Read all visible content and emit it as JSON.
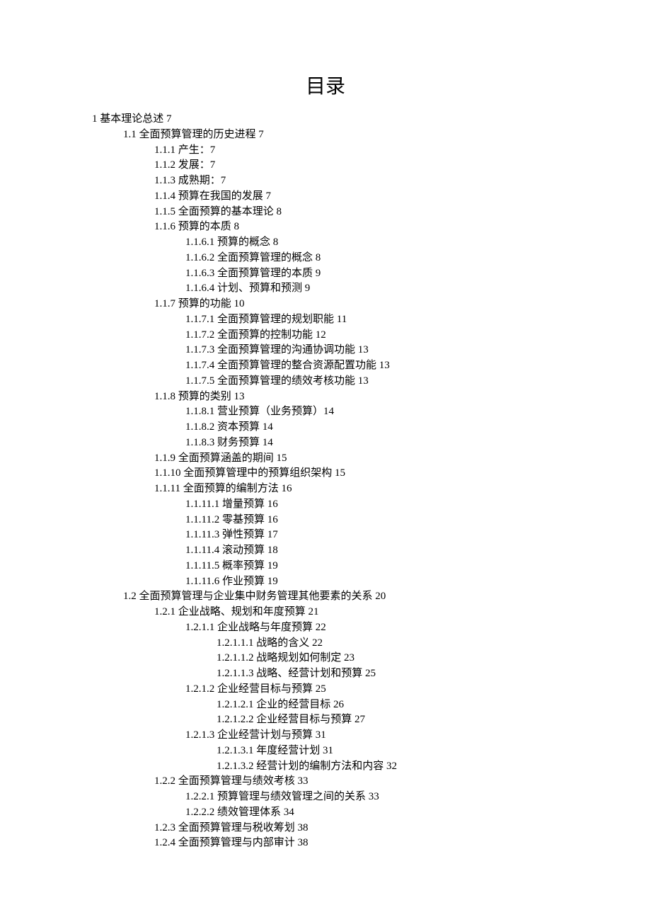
{
  "title": "目录",
  "toc": [
    {
      "level": 1,
      "text": "1 基本理论总述 7"
    },
    {
      "level": 2,
      "text": "1.1 全面预算管理的历史进程 7"
    },
    {
      "level": 3,
      "text": "1.1.1 产生：7"
    },
    {
      "level": 3,
      "text": "1.1.2 发展：7"
    },
    {
      "level": 3,
      "text": "1.1.3 成熟期：7"
    },
    {
      "level": 3,
      "text": "1.1.4 预算在我国的发展 7"
    },
    {
      "level": 3,
      "text": "1.1.5 全面预算的基本理论 8"
    },
    {
      "level": 3,
      "text": "1.1.6 预算的本质 8"
    },
    {
      "level": 4,
      "text": "1.1.6.1 预算的概念 8"
    },
    {
      "level": 4,
      "text": "1.1.6.2 全面预算管理的概念 8"
    },
    {
      "level": 4,
      "text": "1.1.6.3 全面预算管理的本质 9"
    },
    {
      "level": 4,
      "text": "1.1.6.4 计划、预算和预测 9"
    },
    {
      "level": 3,
      "text": "1.1.7 预算的功能 10"
    },
    {
      "level": 4,
      "text": "1.1.7.1 全面预算管理的规划职能 11"
    },
    {
      "level": 4,
      "text": "1.1.7.2 全面预算的控制功能 12"
    },
    {
      "level": 4,
      "text": "1.1.7.3 全面预算管理的沟通协调功能 13"
    },
    {
      "level": 4,
      "text": "1.1.7.4 全面预算管理的整合资源配置功能 13"
    },
    {
      "level": 4,
      "text": "1.1.7.5 全面预算管理的绩效考核功能 13"
    },
    {
      "level": 3,
      "text": "1.1.8 预算的类别 13"
    },
    {
      "level": 4,
      "text": "1.1.8.1 营业预算（业务预算）14"
    },
    {
      "level": 4,
      "text": "1.1.8.2 资本预算 14"
    },
    {
      "level": 4,
      "text": "1.1.8.3 财务预算 14"
    },
    {
      "level": 3,
      "text": "1.1.9 全面预算涵盖的期间 15"
    },
    {
      "level": 3,
      "text": "1.1.10 全面预算管理中的预算组织架构 15"
    },
    {
      "level": 3,
      "text": "1.1.11 全面预算的编制方法 16"
    },
    {
      "level": 4,
      "text": "1.1.11.1 增量预算 16"
    },
    {
      "level": 4,
      "text": "1.1.11.2 零基预算 16"
    },
    {
      "level": 4,
      "text": "1.1.11.3 弹性预算 17"
    },
    {
      "level": 4,
      "text": "1.1.11.4 滚动预算 18"
    },
    {
      "level": 4,
      "text": "1.1.11.5 概率预算 19"
    },
    {
      "level": 4,
      "text": "1.1.11.6 作业预算 19"
    },
    {
      "level": 2,
      "text": "1.2 全面预算管理与企业集中财务管理其他要素的关系 20"
    },
    {
      "level": 3,
      "text": "1.2.1 企业战略、规划和年度预算 21"
    },
    {
      "level": 4,
      "text": "1.2.1.1 企业战略与年度预算 22"
    },
    {
      "level": 5,
      "text": "1.2.1.1.1 战略的含义 22"
    },
    {
      "level": 5,
      "text": "1.2.1.1.2 战略规划如何制定 23"
    },
    {
      "level": 5,
      "text": "1.2.1.1.3 战略、经营计划和预算 25"
    },
    {
      "level": 4,
      "text": "1.2.1.2 企业经营目标与预算 25"
    },
    {
      "level": 5,
      "text": "1.2.1.2.1 企业的经营目标 26"
    },
    {
      "level": 5,
      "text": "1.2.1.2.2 企业经营目标与预算 27"
    },
    {
      "level": 4,
      "text": "1.2.1.3 企业经营计划与预算 31"
    },
    {
      "level": 5,
      "text": "1.2.1.3.1 年度经营计划 31"
    },
    {
      "level": 5,
      "text": "1.2.1.3.2 经营计划的编制方法和内容 32"
    },
    {
      "level": 3,
      "text": "1.2.2 全面预算管理与绩效考核 33"
    },
    {
      "level": 4,
      "text": "1.2.2.1 预算管理与绩效管理之间的关系 33"
    },
    {
      "level": 4,
      "text": "1.2.2.2 绩效管理体系 34"
    },
    {
      "level": 3,
      "text": "1.2.3 全面预算管理与税收筹划 38"
    },
    {
      "level": 3,
      "text": "1.2.4 全面预算管理与内部审计 38"
    }
  ]
}
